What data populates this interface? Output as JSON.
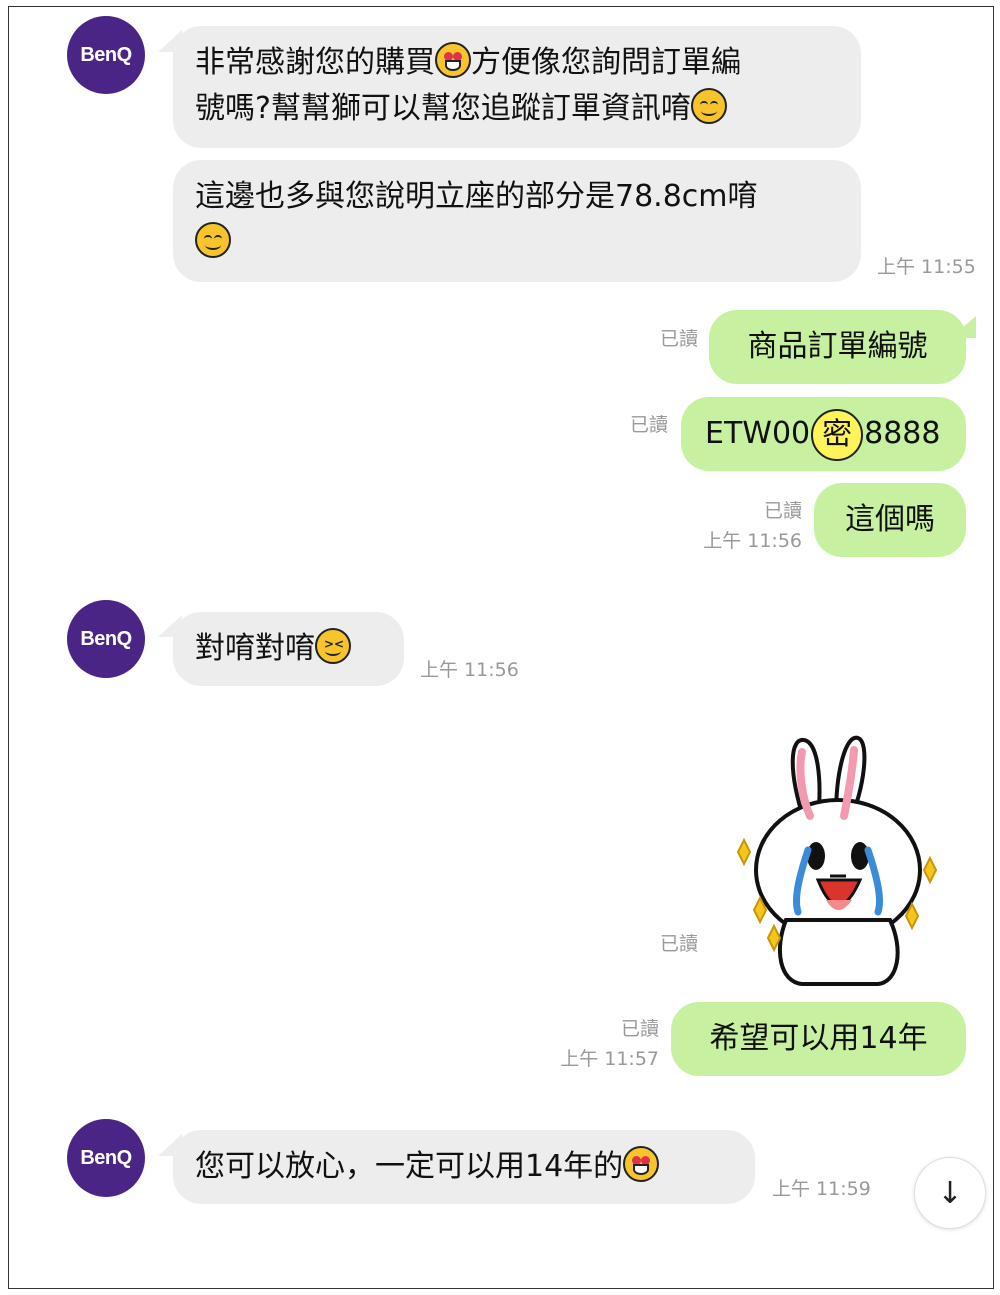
{
  "brand": {
    "avatar_label": "BenQ",
    "avatar_color": "#4b2585"
  },
  "colors": {
    "incoming_bubble": "#ededed",
    "outgoing_bubble": "#c7f1a0",
    "meta_text": "#999999"
  },
  "messages": [
    {
      "side": "in",
      "lines": [
        "非常感謝您的購買",
        "方便像您詢問訂單編",
        "號嗎?幫幫獅可以幫您追蹤訂單資訊唷"
      ],
      "emojis": [
        "heart-eyes-emoji",
        "smile-emoji"
      ]
    },
    {
      "side": "in",
      "lines": [
        "這邊也多與您說明立座的部分是78.8cm唷"
      ],
      "emojis": [
        "smile-emoji"
      ],
      "time": "上午 11:55"
    },
    {
      "side": "out",
      "text": "商品訂單編號",
      "read": "已讀"
    },
    {
      "side": "out",
      "text_prefix": "ETW00",
      "masked_char": "密",
      "text_suffix": "8888",
      "read": "已讀"
    },
    {
      "side": "out",
      "text": "這個嗎",
      "read": "已讀",
      "time": "上午 11:56"
    },
    {
      "side": "in",
      "text": "對唷對唷",
      "emojis": [
        "squinting-laugh-emoji"
      ],
      "time": "上午 11:56"
    },
    {
      "side": "out",
      "type": "sticker",
      "sticker": "crying-rabbit-sticker",
      "read": "已讀"
    },
    {
      "side": "out",
      "text": "希望可以用14年",
      "read": "已讀",
      "time": "上午 11:57"
    },
    {
      "side": "in",
      "text": "您可以放心，一定可以用14年的",
      "emojis": [
        "heart-eyes-emoji"
      ],
      "time": "上午 11:59"
    }
  ],
  "scroll_button": {
    "icon": "arrow-down-icon",
    "glyph": "↓"
  }
}
